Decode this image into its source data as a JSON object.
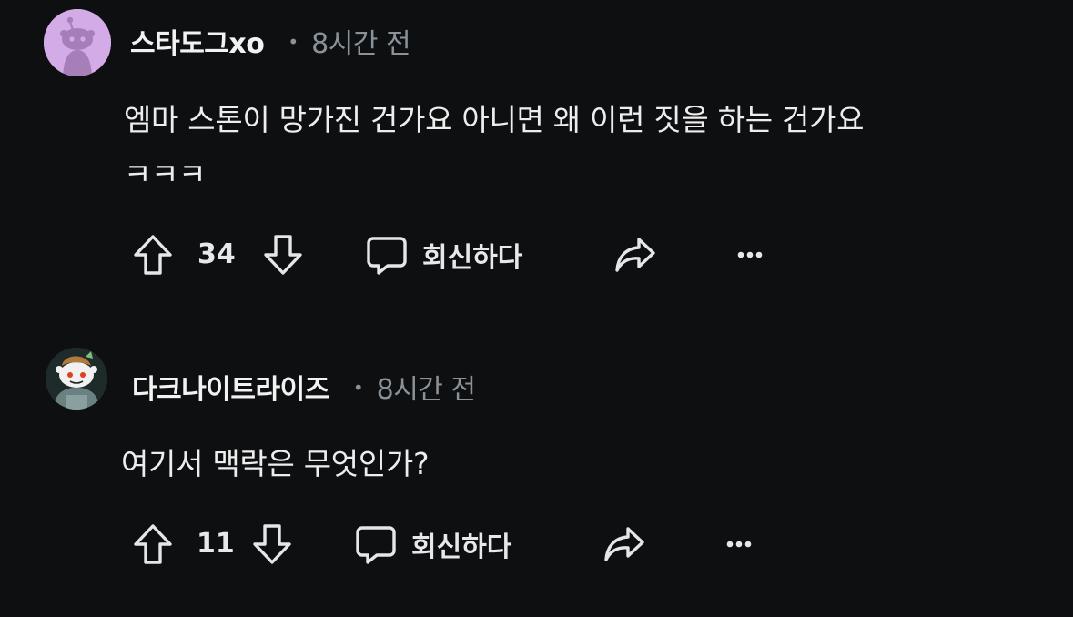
{
  "comments": [
    {
      "username": "스타도그xo",
      "separator": "•",
      "time": "8시간 전",
      "text_line1": "엠마 스톤이 망가진 건가요 아니면 왜 이런 짓을 하는 건가요",
      "text_line2": "ㅋㅋㅋ",
      "score": "34",
      "reply_label": "회신하다",
      "avatar_icon": "reddit-snoo-avatar",
      "avatar_color": "#d3abe7"
    },
    {
      "username": "다크나이트라이즈",
      "separator": "•",
      "time": "8시간 전",
      "text_line1": "여기서 맥락은 무엇인가?",
      "score": "11",
      "reply_label": "회신하다",
      "avatar_icon": "reddit-snoo-custom-avatar",
      "avatar_color": "#1f2a2a"
    }
  ],
  "icons": {
    "upvote": "upvote-arrow-icon",
    "downvote": "downvote-arrow-icon",
    "reply": "speech-bubble-icon",
    "share": "share-arrow-icon",
    "more": "more-options-icon"
  },
  "colors": {
    "background": "#0e0f11",
    "text": "#ededed",
    "muted": "#8a9299"
  }
}
